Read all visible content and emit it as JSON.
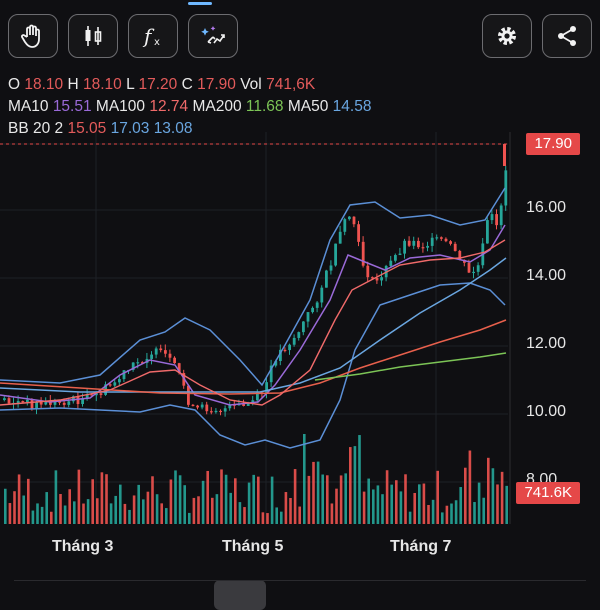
{
  "toolbar": {
    "buttons": [
      {
        "icon": "hand-icon"
      },
      {
        "icon": "candlestick-icon"
      },
      {
        "icon": "function-icon"
      },
      {
        "icon": "magic-wand-icon"
      }
    ],
    "settings_icon": "gear-icon",
    "share_icon": "share-icon"
  },
  "ohlc": {
    "o_label": "O",
    "o": "18.10",
    "h_label": "H",
    "h": "18.10",
    "l_label": "L",
    "l": "17.20",
    "c_label": "C",
    "c": "17.90",
    "vol_label": "Vol",
    "vol": "741,6K"
  },
  "ma": {
    "ma10_label": "MA10",
    "ma10": "15.51",
    "ma100_label": "MA100",
    "ma100": "12.74",
    "ma200_label": "MA200",
    "ma200": "11.68",
    "ma50_label": "MA50",
    "ma50": "14.58"
  },
  "bb": {
    "label": "BB 20 2",
    "upper": "15.05",
    "mid": "17.03",
    "lower": "13.08"
  },
  "price_badge": "17.90",
  "volume_badge": "741.6K",
  "colors": {
    "up": "#26a69a",
    "down": "#ef5350",
    "ma10": "#9a6ad8",
    "ma100": "#e8604c",
    "ma200": "#7cc456",
    "ma50": "#6aa6e0",
    "bb": "#5b8fd6"
  },
  "chart_data": {
    "type": "candlestick",
    "y_ticks": [
      "16.00",
      "14.00",
      "12.00",
      "10.00",
      "8.00"
    ],
    "x_ticks": [
      "Tháng 3",
      "Tháng 5",
      "Tháng 7"
    ],
    "last_price": 17.9
  }
}
